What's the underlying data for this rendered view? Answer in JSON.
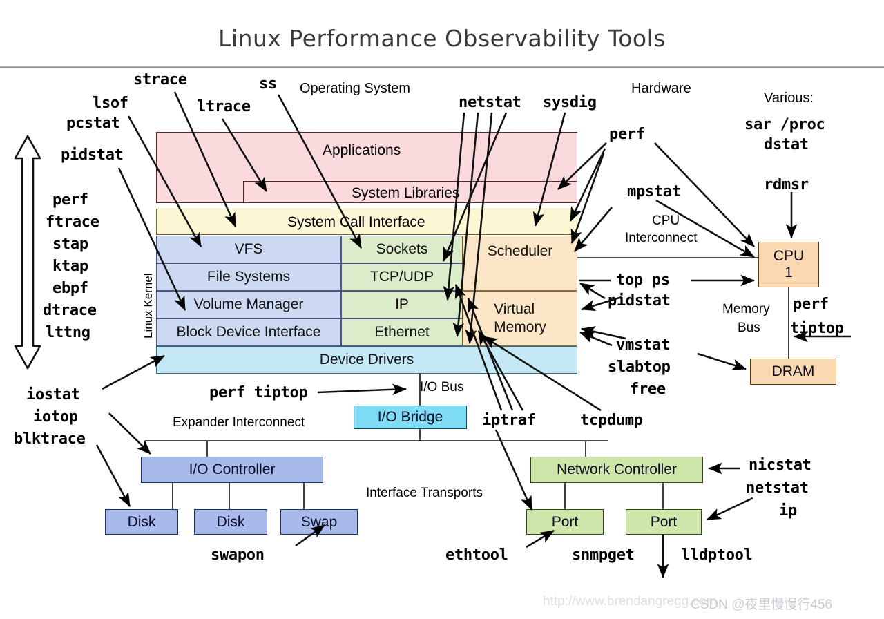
{
  "title": "Linux Performance Observability Tools",
  "section_labels": {
    "operating_system": "Operating System",
    "hardware": "Hardware",
    "various": "Various:",
    "linux_kernel": "Linux Kernel",
    "cpu_interconnect_1": "CPU",
    "cpu_interconnect_2": "Interconnect",
    "memory_bus_1": "Memory",
    "memory_bus_2": "Bus",
    "io_bus": "I/O Bus",
    "expander_interconnect": "Expander Interconnect",
    "interface_transports": "Interface Transports"
  },
  "stack": {
    "applications": "Applications",
    "system_libraries": "System Libraries",
    "system_call_interface": "System Call Interface",
    "file_column": [
      "VFS",
      "File Systems",
      "Volume Manager",
      "Block Device Interface"
    ],
    "net_column": [
      "Sockets",
      "TCP/UDP",
      "IP",
      "Ethernet"
    ],
    "cpu_column": [
      "Scheduler",
      "Virtual Memory"
    ],
    "device_drivers": "Device Drivers"
  },
  "hardware": {
    "cpu": "CPU\n1",
    "cpu_line1": "CPU",
    "cpu_line2": "1",
    "dram": "DRAM",
    "io_bridge": "I/O Bridge",
    "io_controller": "I/O Controller",
    "network_controller": "Network Controller",
    "disk1": "Disk",
    "disk2": "Disk",
    "swap": "Swap",
    "port1": "Port",
    "port2": "Port"
  },
  "tools": {
    "strace": "strace",
    "ss": "ss",
    "lsof": "lsof",
    "pcstat": "pcstat",
    "ltrace": "ltrace",
    "pidstat_left": "pidstat",
    "netstat_top": "netstat",
    "sysdig": "sysdig",
    "perf_top": "perf",
    "mpstat": "mpstat",
    "sar_proc": "sar /proc",
    "dstat": "dstat",
    "rdmsr": "rdmsr",
    "kernel_tracers": [
      "perf",
      "ftrace",
      "stap",
      "ktap",
      "ebpf",
      "dtrace",
      "lttng"
    ],
    "top_ps": "top ps",
    "pidstat_cpu": "pidstat",
    "perf_mem": "perf",
    "tiptop_mem": "tiptop",
    "vmstat": "vmstat",
    "slabtop": "slabtop",
    "free": "free",
    "iostat": "iostat",
    "iotop": "iotop",
    "blktrace": "blktrace",
    "perf_tiptop_io": "perf tiptop",
    "iptraf": "iptraf",
    "tcpdump": "tcpdump",
    "swapon": "swapon",
    "nicstat": "nicstat",
    "netstat_nic": "netstat",
    "ip": "ip",
    "ethtool": "ethtool",
    "snmpget": "snmpget",
    "lldptool": "lldptool"
  },
  "watermark": {
    "url": "http://www.brendangregg.com",
    "csdn": "CSDN @夜里慢慢行456"
  },
  "colors": {
    "applications": "#fadadd",
    "syscall": "#fbf7d5",
    "filesystem": "#cdd9f3",
    "network": "#dceccb",
    "cpu_mem": "#fbe6c8",
    "device_drivers": "#c5e8f7",
    "io_bridge": "#7fdcf5",
    "io_controller": "#a8b9ec",
    "net_controller": "#cfe6ab",
    "hardware_box": "#fad9b0",
    "title": "#3a3a3a"
  }
}
